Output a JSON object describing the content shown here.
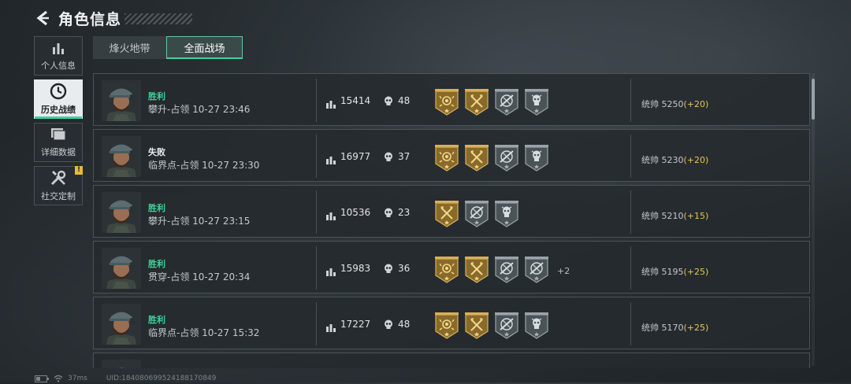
{
  "header": {
    "title": "角色信息"
  },
  "sidebar": {
    "items": [
      {
        "label": "个人信息",
        "icon": "bar-chart-icon"
      },
      {
        "label": "历史战绩",
        "icon": "clock-icon",
        "active": true
      },
      {
        "label": "详细数据",
        "icon": "folder-icon"
      },
      {
        "label": "社交定制",
        "icon": "tools-icon",
        "badge": "!"
      }
    ]
  },
  "tabs": [
    {
      "label": "烽火地带"
    },
    {
      "label": "全面战场",
      "active": true
    }
  ],
  "matches": [
    {
      "result": "胜利",
      "result_color": "#3fd19a",
      "mode": "攀升-占领 10-27 23:46",
      "score": "15414",
      "kills": "48",
      "medals": [
        "gold-rose",
        "gold-axes",
        "silver-crossed",
        "silver-skull"
      ],
      "more": "",
      "rating_label": "统帅",
      "rating": "5250",
      "delta": "(+20)"
    },
    {
      "result": "失败",
      "result_color": "#e9ecee",
      "mode": "临界点-占领 10-27 23:30",
      "score": "16977",
      "kills": "37",
      "medals": [
        "gold-rose",
        "gold-axes",
        "silver-crossed",
        "silver-skull"
      ],
      "more": "",
      "rating_label": "统帅",
      "rating": "5230",
      "delta": "(+20)"
    },
    {
      "result": "胜利",
      "result_color": "#3fd19a",
      "mode": "攀升-占领 10-27 23:15",
      "score": "10536",
      "kills": "23",
      "medals": [
        "gold-axes",
        "silver-crossed",
        "silver-skull"
      ],
      "more": "",
      "rating_label": "统帅",
      "rating": "5210",
      "delta": "(+15)"
    },
    {
      "result": "胜利",
      "result_color": "#3fd19a",
      "mode": "贯穿-占领 10-27 20:34",
      "score": "15983",
      "kills": "36",
      "medals": [
        "gold-rose",
        "gold-axes",
        "silver-crossed",
        "silver-crossed"
      ],
      "more": "+2",
      "rating_label": "统帅",
      "rating": "5195",
      "delta": "(+25)"
    },
    {
      "result": "胜利",
      "result_color": "#3fd19a",
      "mode": "临界点-占领 10-27 15:32",
      "score": "17227",
      "kills": "48",
      "medals": [
        "gold-rose",
        "gold-axes",
        "silver-crossed",
        "silver-skull"
      ],
      "more": "",
      "rating_label": "统帅",
      "rating": "5170",
      "delta": "(+25)"
    }
  ],
  "footer": {
    "ping": "37ms",
    "uid": "UID:1840806995241881708​49"
  },
  "colors": {
    "accent": "#3fd1a0",
    "gold": "#e8c35a",
    "badge": "#e8b93a"
  }
}
